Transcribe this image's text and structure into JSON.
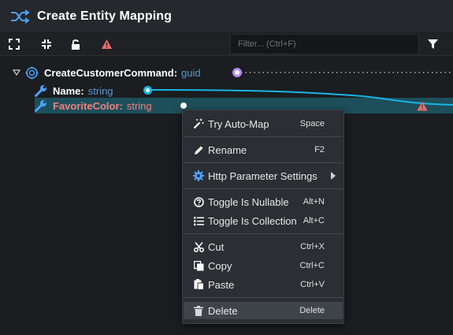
{
  "window": {
    "title": "Create Entity Mapping"
  },
  "toolbar": {
    "filter_placeholder": "Filter... (Ctrl+F)"
  },
  "tree": {
    "root": {
      "name": "CreateCustomerCommand:",
      "type": "guid"
    },
    "children": [
      {
        "name": "Name:",
        "type": "string"
      },
      {
        "name": "FavoriteColor:",
        "type": "string",
        "warning": true,
        "selected": true
      }
    ]
  },
  "context_menu": {
    "items": [
      {
        "label": "Try Auto-Map",
        "shortcut": "Space",
        "icon": "magic-wand-icon"
      },
      {
        "label": "Rename",
        "shortcut": "F2",
        "icon": "pencil-icon"
      },
      {
        "label": "Http Parameter Settings",
        "shortcut": "",
        "icon": "gear-icon",
        "submenu": true
      },
      {
        "label": "Toggle Is Nullable",
        "shortcut": "Alt+N",
        "icon": "question-circle-icon"
      },
      {
        "label": "Toggle Is Collection",
        "shortcut": "Alt+C",
        "icon": "list-icon"
      },
      {
        "label": "Cut",
        "shortcut": "Ctrl+X",
        "icon": "scissors-icon"
      },
      {
        "label": "Copy",
        "shortcut": "Ctrl+C",
        "icon": "copy-icon"
      },
      {
        "label": "Paste",
        "shortcut": "Ctrl+V",
        "icon": "paste-icon"
      },
      {
        "label": "Delete",
        "shortcut": "Delete",
        "icon": "trash-icon",
        "highlighted": true
      }
    ]
  },
  "colors": {
    "accent_cyan": "#19b5e6",
    "type_blue": "#569cd6",
    "warning_red": "#f08080",
    "root_port_purple": "#b68cf0",
    "selected_row": "#1d4f5a"
  }
}
